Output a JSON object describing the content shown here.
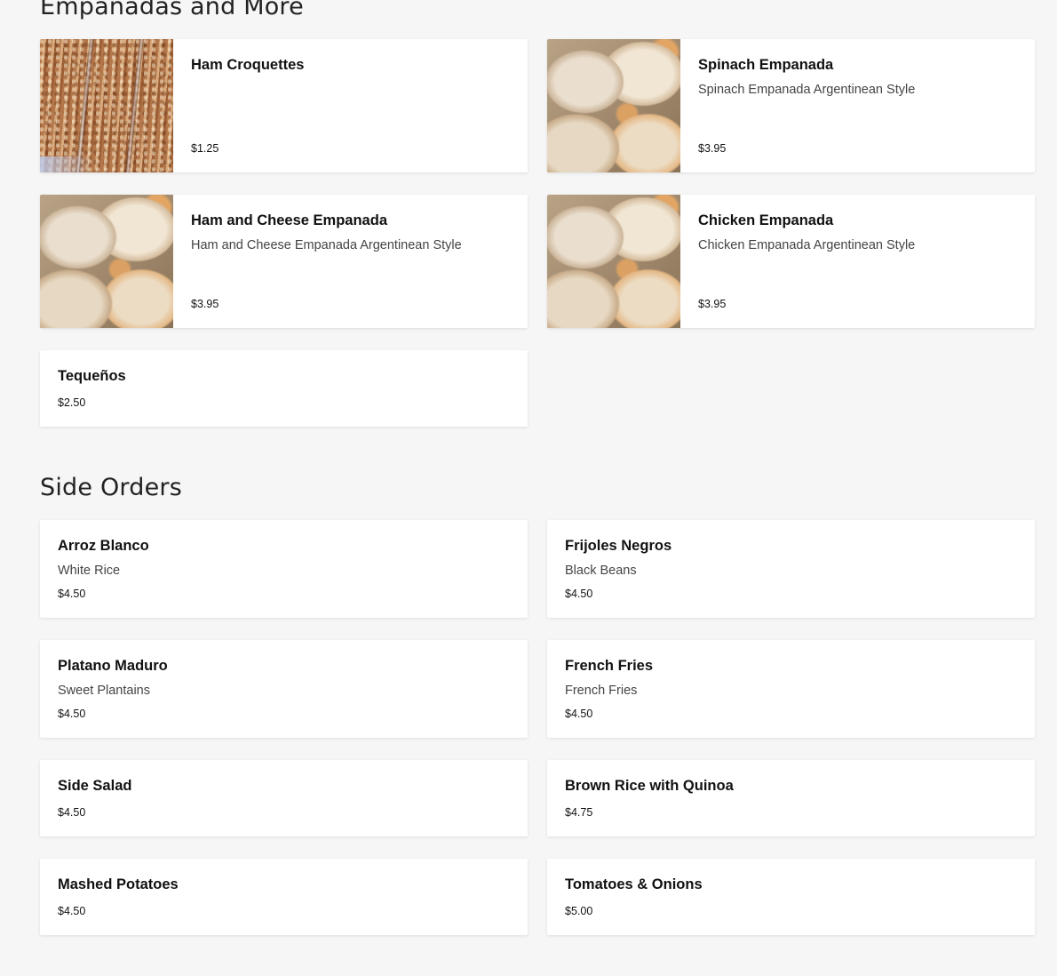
{
  "sections": [
    {
      "title": "Empanadas and More",
      "items": [
        {
          "name": "Ham Croquettes",
          "description": "",
          "price": "$1.25",
          "image": "ham-croquettes-photo"
        },
        {
          "name": "Spinach Empanada",
          "description": "Spinach Empanada Argentinean Style",
          "price": "$3.95",
          "image": "empanada-photo"
        },
        {
          "name": "Ham and Cheese Empanada",
          "description": "Ham and Cheese Empanada Argentinean Style",
          "price": "$3.95",
          "image": "empanada-photo"
        },
        {
          "name": "Chicken Empanada",
          "description": "Chicken Empanada Argentinean Style",
          "price": "$3.95",
          "image": "empanada-photo"
        },
        {
          "name": "Tequeños",
          "description": "",
          "price": "$2.50",
          "image": ""
        }
      ]
    },
    {
      "title": "Side Orders",
      "items": [
        {
          "name": "Arroz Blanco",
          "description": "White Rice",
          "price": "$4.50"
        },
        {
          "name": "Frijoles Negros",
          "description": "Black Beans",
          "price": "$4.50"
        },
        {
          "name": "Platano Maduro",
          "description": "Sweet Plantains",
          "price": "$4.50"
        },
        {
          "name": "French Fries",
          "description": "French Fries",
          "price": "$4.50"
        },
        {
          "name": "Side Salad",
          "description": "",
          "price": "$4.50"
        },
        {
          "name": "Brown Rice with Quinoa",
          "description": "",
          "price": "$4.75"
        },
        {
          "name": "Mashed Potatoes",
          "description": "",
          "price": "$4.50"
        },
        {
          "name": "Tomatoes & Onions",
          "description": "",
          "price": "$5.00"
        }
      ]
    }
  ]
}
